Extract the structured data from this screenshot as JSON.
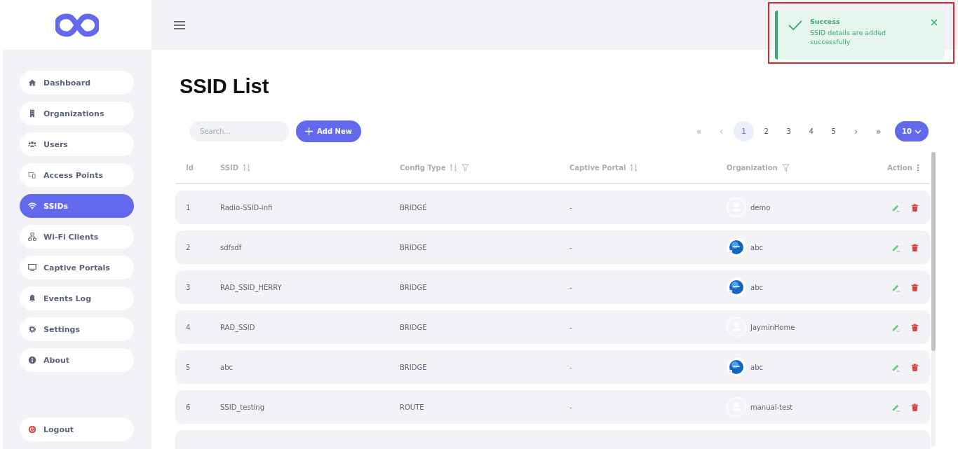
{
  "sidebar": {
    "items": [
      {
        "label": "Dashboard",
        "selected": false
      },
      {
        "label": "Organizations",
        "selected": false
      },
      {
        "label": "Users",
        "selected": false
      },
      {
        "label": "Access Points",
        "selected": false
      },
      {
        "label": "SSIDs",
        "selected": true
      },
      {
        "label": "Wi-Fi Clients",
        "selected": false
      },
      {
        "label": "Captive Portals",
        "selected": false
      },
      {
        "label": "Events Log",
        "selected": false
      },
      {
        "label": "Settings",
        "selected": false
      },
      {
        "label": "About",
        "selected": false
      }
    ],
    "logout": {
      "label": "Logout"
    }
  },
  "toast": {
    "title": "Success",
    "message": "SSID details are added successfully"
  },
  "page_title": "SSID List",
  "search": {
    "placeholder": "Search..."
  },
  "add_button": {
    "label": "Add New"
  },
  "pagination": {
    "first": "«",
    "prev": "‹",
    "next": "›",
    "last": "»",
    "pages": [
      {
        "label": "1",
        "selected": true
      },
      {
        "label": "2",
        "selected": false
      },
      {
        "label": "3",
        "selected": false
      },
      {
        "label": "4",
        "selected": false
      },
      {
        "label": "5",
        "selected": false
      }
    ],
    "page_size": "10"
  },
  "table": {
    "columns": [
      {
        "label": "Id",
        "sortable": false,
        "filterable": false
      },
      {
        "label": "SSID",
        "sortable": true,
        "filterable": false
      },
      {
        "label": "Config Type",
        "sortable": true,
        "filterable": true
      },
      {
        "label": "Captive Portal",
        "sortable": true,
        "filterable": false
      },
      {
        "label": "Organization",
        "sortable": false,
        "filterable": true
      },
      {
        "label": "Action",
        "sortable": false,
        "filterable": false
      }
    ],
    "rows": [
      {
        "id": "1",
        "ssid": "Radio-SSID-infi",
        "config_type": "BRIDGE",
        "captive_portal": "-",
        "organization": "demo",
        "avatar": {
          "kind": "placeholder"
        }
      },
      {
        "id": "2",
        "ssid": "sdfsdf",
        "config_type": "BRIDGE",
        "captive_portal": "-",
        "organization": "abc"
      },
      {
        "id": "3",
        "ssid": "RAD_SSID_HERRY",
        "config_type": "BRIDGE",
        "captive_portal": "-",
        "organization": "abc"
      },
      {
        "id": "4",
        "ssid": "RAD_SSID",
        "config_type": "BRIDGE",
        "captive_portal": "-",
        "organization": "JayminHome",
        "avatar": {
          "kind": "placeholder"
        }
      },
      {
        "id": "5",
        "ssid": "abc",
        "config_type": "BRIDGE",
        "captive_portal": "-",
        "organization": "abc"
      },
      {
        "id": "6",
        "ssid": "SSID_testing",
        "config_type": "ROUTE",
        "captive_portal": "-",
        "organization": "manual-test",
        "avatar": {
          "kind": "placeholder"
        }
      }
    ]
  }
}
